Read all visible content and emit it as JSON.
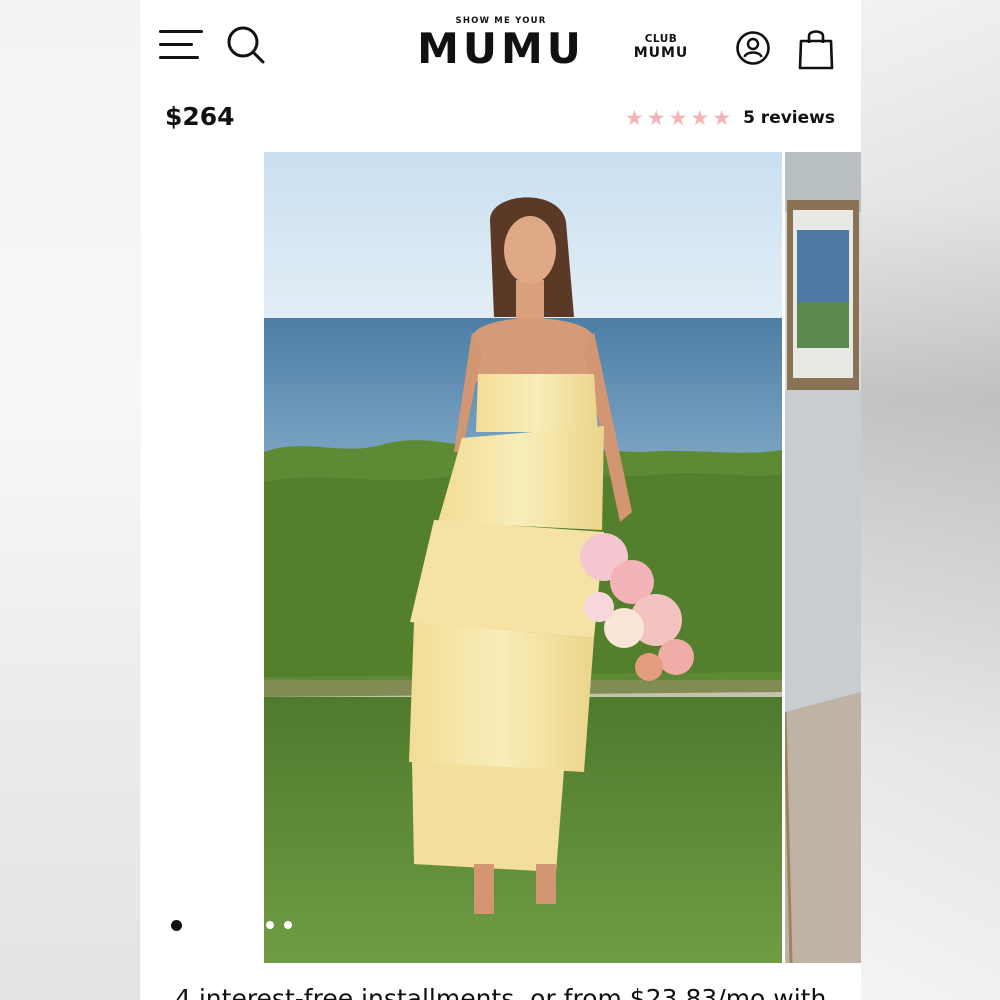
{
  "header": {
    "brand_small": "SHOW ME YOUR",
    "brand_name": "MUMU",
    "club_line1": "CLUB",
    "club_line2": "MUMU",
    "icons": [
      "menu-icon",
      "search-icon",
      "account-icon",
      "shopping-bag-icon"
    ]
  },
  "product": {
    "price": "$264",
    "rating": 5,
    "reviews_label": "5 reviews",
    "installments_text": "4 interest-free installments, or from $23.83/mo with"
  },
  "gallery": {
    "active_index": 0,
    "dot_count": 3
  },
  "colors": {
    "star": "#f3b4b6",
    "dress": "#f5e7a8",
    "sky": "#cfe3f2",
    "sea": "#5b88ad",
    "grass": "#5d8a3a"
  }
}
